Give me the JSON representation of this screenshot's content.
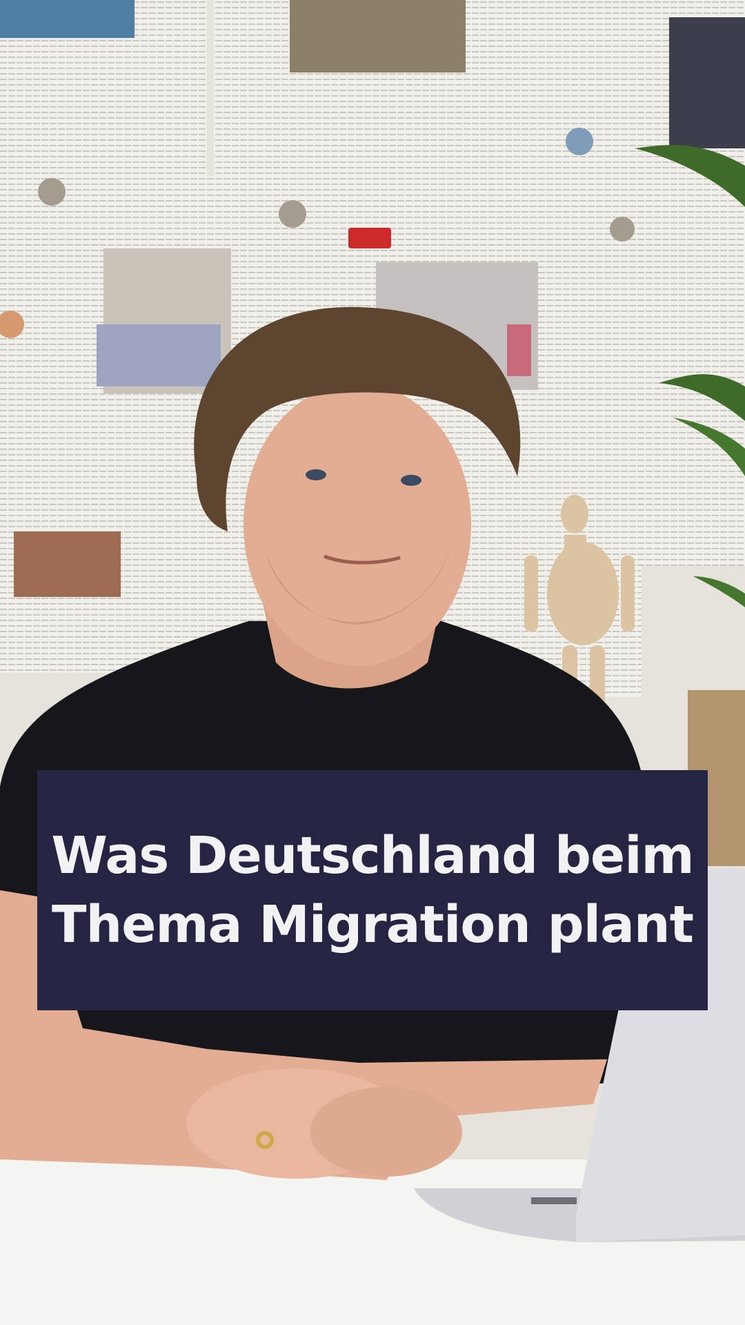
{
  "overlay": {
    "headline_lines": [
      "Was Deutschland beim",
      "Thema Migration plant"
    ],
    "background_color": "#262443",
    "text_color": "#f2f2f5"
  },
  "scene": {
    "colors": {
      "wall": "#e6e3dc",
      "newspaper": "#f1efe9",
      "shirt": "#17171b",
      "skin": "#e2ad92",
      "hair": "#5e4530",
      "desk": "#f4f4f2",
      "laptop": "#d9dadc",
      "plant": "#3e6a2a"
    }
  }
}
